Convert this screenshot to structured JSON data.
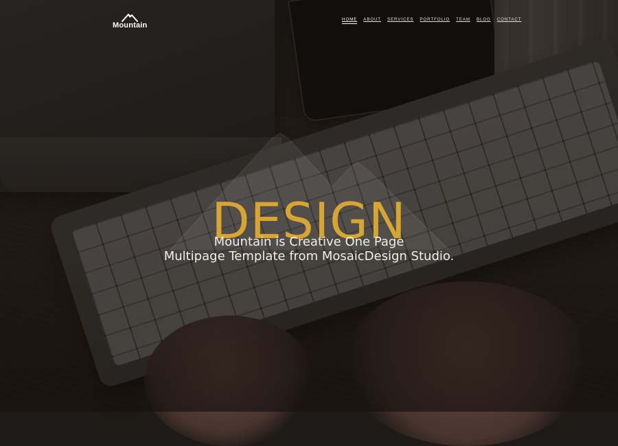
{
  "header": {
    "brand_name": "Mountain",
    "nav_items": [
      {
        "label": "HOME",
        "active": true
      },
      {
        "label": "ABOUT",
        "active": false
      },
      {
        "label": "SERVICES",
        "active": false
      },
      {
        "label": "PORTFOLIO",
        "active": false
      },
      {
        "label": "TEAM",
        "active": false
      },
      {
        "label": "BLOG",
        "active": false
      },
      {
        "label": "CONTACT",
        "active": false
      }
    ]
  },
  "hero": {
    "title": "DESIGN",
    "subtitle_line1": "Mountain is Creative One Page",
    "subtitle_line2": "Multipage Template from MosaicDesign Studio."
  },
  "icons": {
    "brand_logo": "mountain-logo-icon",
    "hero_mark": "mountain-outline-icon"
  },
  "colors": {
    "title_gold": "#d6a532",
    "text_white": "#ffffff"
  }
}
